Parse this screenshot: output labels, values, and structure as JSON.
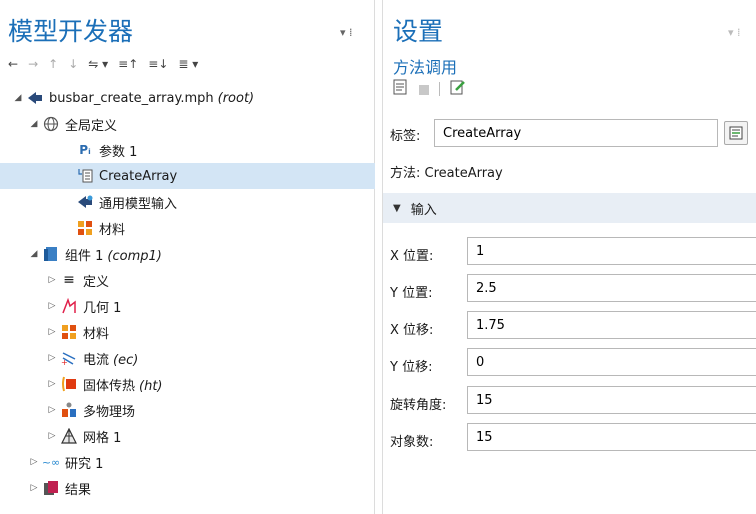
{
  "model_builder": {
    "title": "模型开发器",
    "pin_controls": "▾ ⁞",
    "toolbar": {
      "back": "←",
      "forward": "→",
      "up": "↑",
      "down": "↓",
      "show": "⇋ ▾",
      "expand": "≡↑",
      "collapse": "≡↓",
      "more": "≣ ▾"
    },
    "tree": {
      "root": {
        "label": "busbar_create_array.mph",
        "tag": "(root)"
      },
      "global_definitions": "全局定义",
      "parameters": "参数 1",
      "create_array": "CreateArray",
      "general_model_input": "通用模型输入",
      "materials_global": "材料",
      "component": {
        "label": "组件 1",
        "tag": "(comp1)"
      },
      "definitions": "定义",
      "geometry": "几何 1",
      "materials": "材料",
      "electric_currents": {
        "label": "电流",
        "tag": "(ec)"
      },
      "heat_transfer": {
        "label": "固体传热",
        "tag": "(ht)"
      },
      "multiphysics": "多物理场",
      "mesh": "网格 1",
      "study": "研究 1",
      "results": "结果"
    }
  },
  "settings": {
    "title": "设置",
    "pin_controls": "▾ ⁞",
    "subtitle": "方法调用",
    "label_key": "标签:",
    "label_value": "CreateArray",
    "method_text": "方法:  CreateArray",
    "inputs_section": "输入",
    "fields": [
      {
        "label": "X 位置:",
        "value": "1"
      },
      {
        "label": "Y 位置:",
        "value": "2.5"
      },
      {
        "label": "X 位移:",
        "value": "1.75"
      },
      {
        "label": "Y 位移:",
        "value": "0"
      },
      {
        "label": "旋转角度:",
        "value": "15"
      },
      {
        "label": "对象数:",
        "value": "15"
      }
    ]
  },
  "colors": {
    "title_blue": "#1b6fb8",
    "selection": "#d3e5f5",
    "section_bg": "#e8eef5"
  }
}
